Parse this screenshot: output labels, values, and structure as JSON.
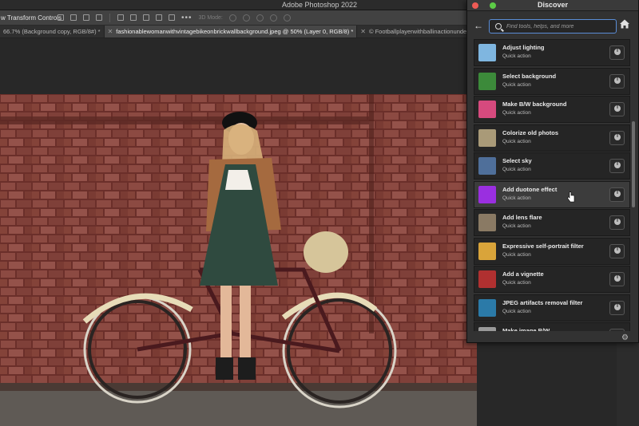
{
  "app": {
    "title": "Adobe Photoshop 2022"
  },
  "options_bar": {
    "transform_label": "w Transform Controls",
    "three_d_label": "3D Mode:"
  },
  "tabs": [
    {
      "label": "66.7% (Background copy, RGB/8#) *",
      "active": false
    },
    {
      "label": "fashionablewomanwithvintagebikeonbrickwallbackground.jpeg @ 50% (Layer 0, RGB/8) *",
      "active": true
    },
    {
      "label": "© Footballplayerwithballinactionunderrain",
      "active": false
    }
  ],
  "discover": {
    "title": "Discover",
    "search": {
      "placeholder": "Find tools, helps, and more",
      "value": ""
    },
    "items": [
      {
        "label": "Adjust lighting",
        "subtitle": "Quick action",
        "thumb_color": "#7fb6e0"
      },
      {
        "label": "Select background",
        "subtitle": "Quick action",
        "thumb_color": "#3c8a3a"
      },
      {
        "label": "Make B/W background",
        "subtitle": "Quick action",
        "thumb_color": "#d64a7e"
      },
      {
        "label": "Colorize old photos",
        "subtitle": "Quick action",
        "thumb_color": "#a99a78"
      },
      {
        "label": "Select sky",
        "subtitle": "Quick action",
        "thumb_color": "#4f6f9a"
      },
      {
        "label": "Add duotone effect",
        "subtitle": "Quick action",
        "thumb_color": "#9a2fe0"
      },
      {
        "label": "Add lens flare",
        "subtitle": "Quick action",
        "thumb_color": "#8a7a64"
      },
      {
        "label": "Expressive self-portrait filter",
        "subtitle": "Quick action",
        "thumb_color": "#d9a43a"
      },
      {
        "label": "Add a vignette",
        "subtitle": "Quick action",
        "thumb_color": "#b03030"
      },
      {
        "label": "JPEG artifacts removal filter",
        "subtitle": "Quick action",
        "thumb_color": "#2b7aa8"
      },
      {
        "label": "Make image B/W",
        "subtitle": "",
        "thumb_color": "#9a9a9a"
      }
    ]
  }
}
